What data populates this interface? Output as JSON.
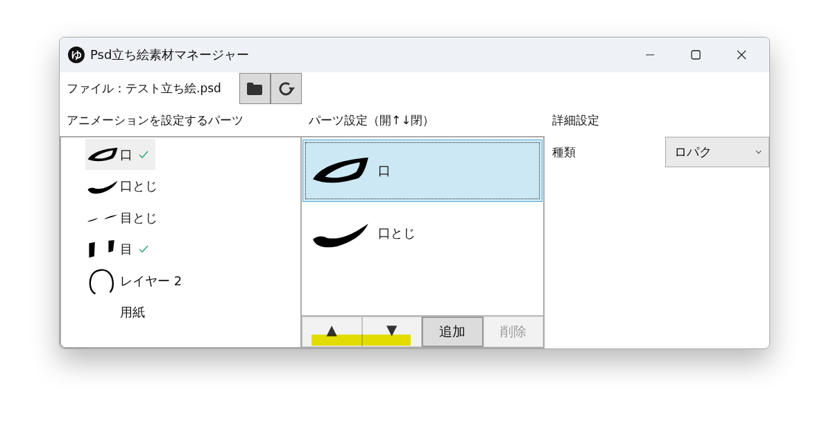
{
  "window": {
    "app_icon": "ゆ",
    "title": "Psd立ち絵素材マネージャー"
  },
  "file_bar": {
    "label": "ファイル：テスト立ち絵.psd"
  },
  "layers_panel": {
    "heading": "アニメーションを設定するパーツ",
    "items": [
      {
        "label": "口",
        "kind": "mouth-open",
        "checked": true,
        "selected": true
      },
      {
        "label": "口とじ",
        "kind": "mouth-closed",
        "checked": false,
        "selected": false
      },
      {
        "label": "目とじ",
        "kind": "eyes-closed",
        "checked": false,
        "selected": false
      },
      {
        "label": "目",
        "kind": "eyes",
        "checked": true,
        "selected": false
      },
      {
        "label": "レイヤー 2",
        "kind": "head",
        "checked": false,
        "selected": false
      },
      {
        "label": "用紙",
        "kind": "blank",
        "checked": false,
        "selected": false
      }
    ]
  },
  "parts_panel": {
    "heading": "パーツ設定（開↑↓閉）",
    "items": [
      {
        "label": "口",
        "kind": "mouth-open",
        "selected": true
      },
      {
        "label": "口とじ",
        "kind": "mouth-closed",
        "selected": false
      }
    ],
    "buttons": [
      {
        "label": "▲",
        "kind": "arrow",
        "disabled": false
      },
      {
        "label": "▼",
        "kind": "arrow",
        "disabled": false
      },
      {
        "label": "追加",
        "kind": "text",
        "disabled": false
      },
      {
        "label": "削除",
        "kind": "text",
        "disabled": true
      }
    ]
  },
  "detail_panel": {
    "heading": "詳細設定",
    "fields": [
      {
        "label": "種類",
        "value": "ロパク"
      }
    ]
  }
}
